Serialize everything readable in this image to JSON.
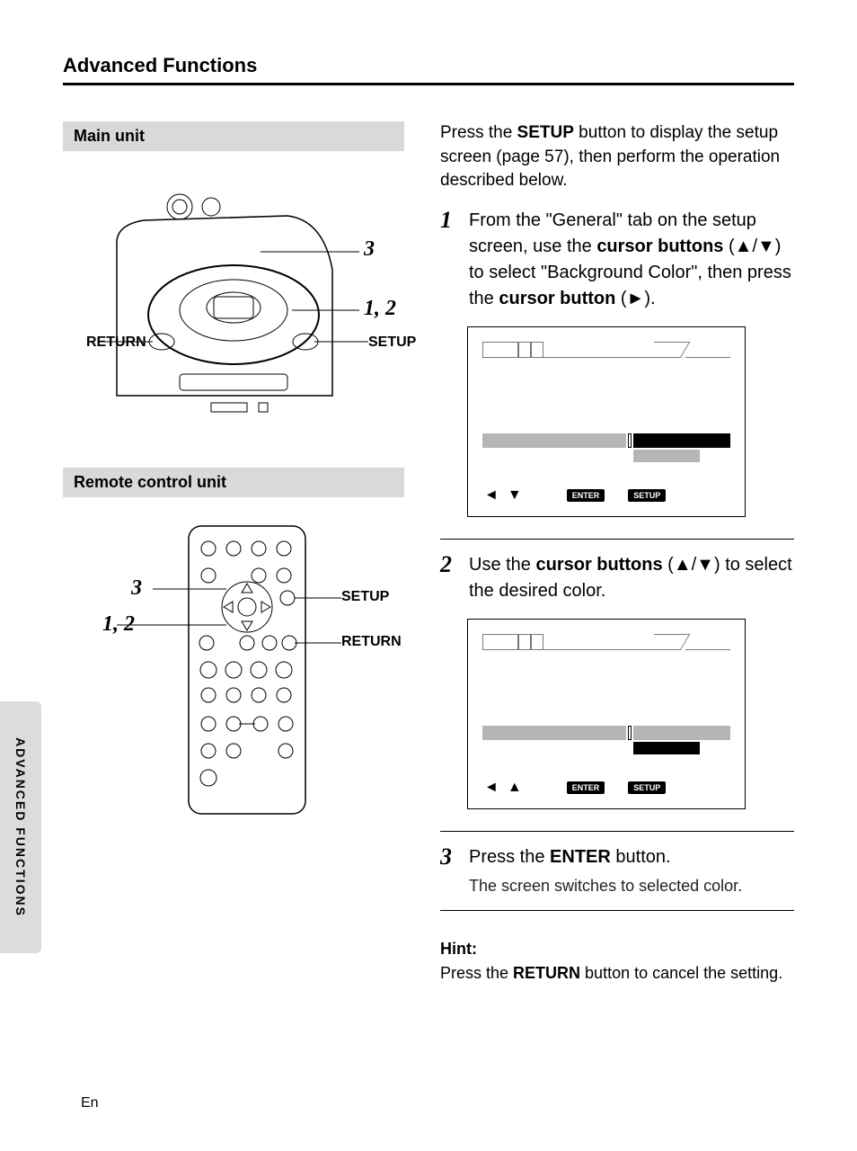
{
  "page": {
    "title": "Advanced Functions",
    "side_tab": "ADVANCED FUNCTIONS",
    "footer": "En"
  },
  "left": {
    "main_unit_label": "Main unit",
    "remote_label": "Remote control unit",
    "callouts": {
      "three": "3",
      "one_two": "1, 2",
      "return": "RETURN",
      "setup": "SETUP"
    }
  },
  "right": {
    "intro_pre": "Press the ",
    "intro_setup": "SETUP",
    "intro_post": " button to display the setup screen (page 57), then perform the operation described below.",
    "step1": {
      "num": "1",
      "t1": "From the \"General\" tab on the setup screen, use the ",
      "t2": "cursor buttons",
      "t3": " (▲/▼) to select \"Background Color\", then press the ",
      "t4": "cursor button",
      "t5": " (►)."
    },
    "step2": {
      "num": "2",
      "t1": "Use the ",
      "t2": "cursor buttons",
      "t3": " (▲/▼) to select the desired color."
    },
    "step3": {
      "num": "3",
      "t1": "Press the ",
      "t2": "ENTER",
      "t3": " button.",
      "sub": "The screen switches to selected color."
    },
    "screen": {
      "enter": "ENTER",
      "setup": "SETUP",
      "arrows1_a": "◄",
      "arrows1_b": "▼",
      "arrows2_a": "◄",
      "arrows2_b": "▲"
    },
    "hint": {
      "title": "Hint:",
      "t1": "Press the ",
      "t2": "RETURN",
      "t3": " button to cancel the setting."
    }
  }
}
